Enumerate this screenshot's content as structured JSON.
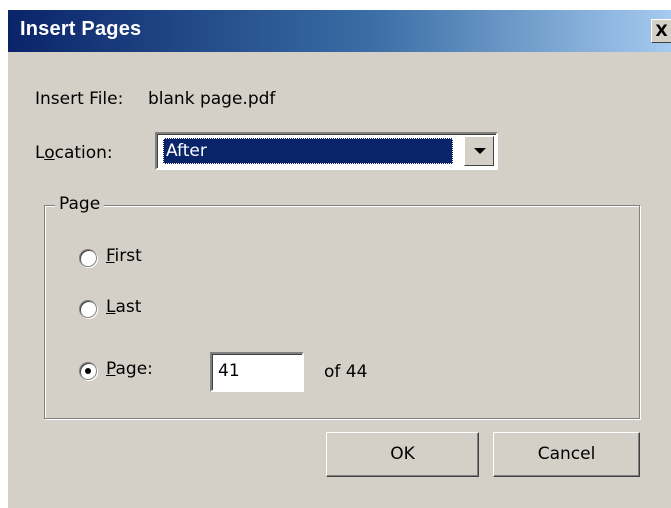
{
  "dialog": {
    "title": "Insert Pages",
    "close_glyph": "X"
  },
  "insert_file": {
    "label": "Insert File:",
    "value": "blank page.pdf"
  },
  "location": {
    "label_pre": "L",
    "label_mnemonic": "o",
    "label_post": "cation:",
    "selected": "After"
  },
  "page_group": {
    "legend": "Page",
    "options": [
      {
        "mnemonic": "F",
        "rest": "irst",
        "selected": false
      },
      {
        "mnemonic": "L",
        "rest": "ast",
        "selected": false
      },
      {
        "mnemonic": "P",
        "rest": "age:",
        "selected": true
      }
    ],
    "page_value": "41",
    "of_text": "of 44"
  },
  "buttons": {
    "ok": "OK",
    "cancel": "Cancel"
  }
}
